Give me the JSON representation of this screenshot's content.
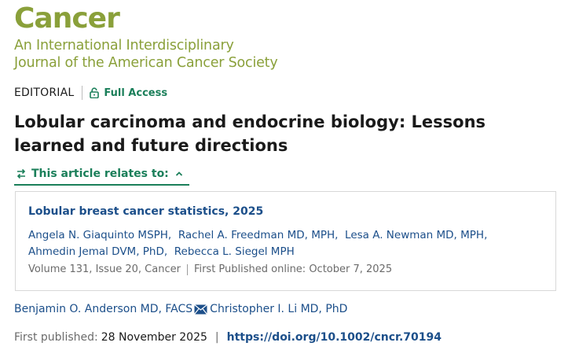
{
  "journal": {
    "title": "Cancer",
    "subtitle_line1": "An International Interdisciplinary",
    "subtitle_line2": "Journal of the American Cancer Society"
  },
  "article": {
    "type": "EDITORIAL",
    "access": "Full Access",
    "title": "Lobular carcinoma and endocrine biology: Lessons learned and future directions",
    "relates_label": "This article relates to:",
    "authors": [
      {
        "name": "Benjamin O. Anderson MD, FACS",
        "has_mail_icon": true
      },
      {
        "name": "Christopher I. Li MD, PhD",
        "has_mail_icon": false
      }
    ],
    "published_label": "First published:",
    "published_date": "28 November 2025",
    "separator": "|",
    "doi": "https://doi.org/10.1002/cncr.70194"
  },
  "related": {
    "title": "Lobular breast cancer statistics, 2025",
    "authors": [
      "Angela N. Giaquinto MSPH,",
      "Rachel A. Freedman MD, MPH,",
      "Lesa A. Newman MD, MPH,",
      "Ahmedin Jemal DVM, PhD,",
      "Rebecca L. Siegel MPH"
    ],
    "volume": "Volume 131,",
    "issue": "Issue 20,",
    "journal": "Cancer",
    "published": "First Published online: October 7, 2025"
  },
  "icons": {
    "access": "lock-open-icon",
    "relates": "swap-arrows-icon",
    "toggle": "chevron-up-icon",
    "contact": "envelope-icon"
  },
  "colors": {
    "brand": "#8aa03a",
    "accent_green": "#1b7f5a",
    "link_blue": "#1c4f8a"
  }
}
